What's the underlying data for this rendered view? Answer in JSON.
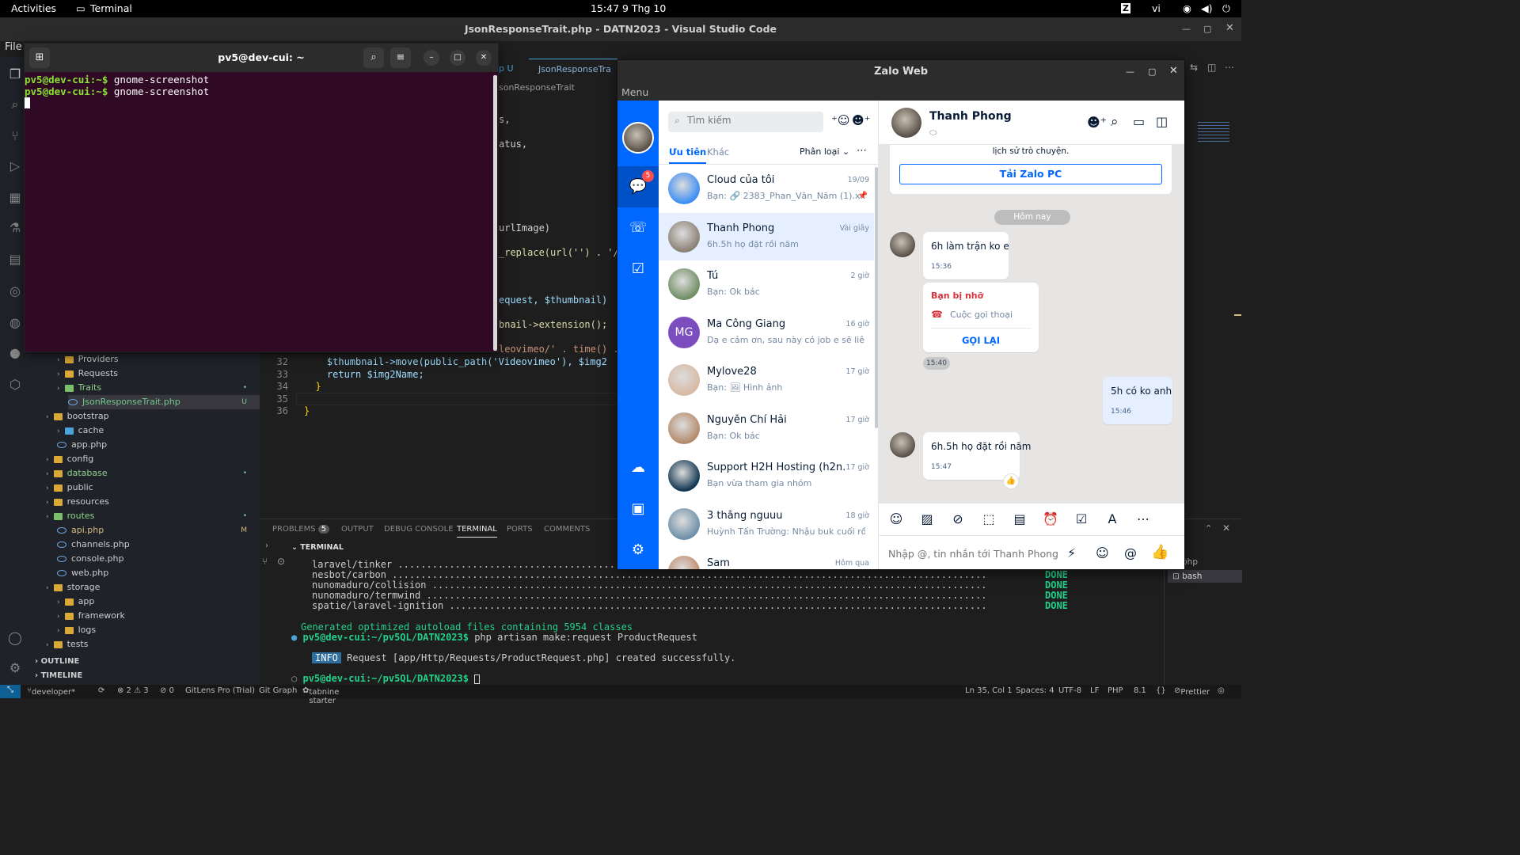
{
  "topbar": {
    "activities": "Activities",
    "app": "Terminal",
    "clock": "15:47  9 Thg 10",
    "lang": "vi"
  },
  "vscode": {
    "title": "JsonResponseTrait.php - DATN2023 - Visual Studio Code",
    "menu_file": "File",
    "tabs": [
      "p U",
      "JsonResponseTra"
    ],
    "breadcrumb": "sonResponseTrait",
    "code_right": [
      {
        "line": "",
        "text": "s,"
      },
      {
        "line": "",
        "text": "atus,"
      },
      {
        "line": "",
        "text": "urlImage)"
      },
      {
        "line": "",
        "text": "_replace(url('') . '/"
      },
      {
        "line": "",
        "text": "equest, $thumbnail)"
      },
      {
        "line": "",
        "text": "bnail->extension();"
      },
      {
        "line": "",
        "text": "leovimeo/' . time() ."
      }
    ],
    "code_lines": [
      {
        "n": "32",
        "text": "    $thumbnail->move(public_path('Videovimeo'), $img2"
      },
      {
        "n": "33",
        "text": "    return $img2Name;"
      },
      {
        "n": "34",
        "text": "  }"
      },
      {
        "n": "35",
        "text": ""
      },
      {
        "n": "36",
        "text": "}"
      }
    ],
    "explorer": [
      {
        "label": "Providers",
        "indent": 1,
        "kind": "folder"
      },
      {
        "label": "Requests",
        "indent": 1,
        "kind": "folder"
      },
      {
        "label": "Traits",
        "indent": 1,
        "kind": "folder-g",
        "badge": "•"
      },
      {
        "label": "JsonResponseTrait.php",
        "indent": 2,
        "kind": "php",
        "badge": "U"
      },
      {
        "label": "bootstrap",
        "indent": 0,
        "kind": "folder"
      },
      {
        "label": "cache",
        "indent": 1,
        "kind": "folder-b"
      },
      {
        "label": "app.php",
        "indent": 1,
        "kind": "php"
      },
      {
        "label": "config",
        "indent": 0,
        "kind": "folder"
      },
      {
        "label": "database",
        "indent": 0,
        "kind": "folder",
        "badge": "•"
      },
      {
        "label": "public",
        "indent": 0,
        "kind": "folder"
      },
      {
        "label": "resources",
        "indent": 0,
        "kind": "folder"
      },
      {
        "label": "routes",
        "indent": 0,
        "kind": "folder-g",
        "badge": "•"
      },
      {
        "label": "api.php",
        "indent": 1,
        "kind": "php",
        "badge": "M"
      },
      {
        "label": "channels.php",
        "indent": 1,
        "kind": "php"
      },
      {
        "label": "console.php",
        "indent": 1,
        "kind": "php"
      },
      {
        "label": "web.php",
        "indent": 1,
        "kind": "php"
      },
      {
        "label": "storage",
        "indent": 0,
        "kind": "folder"
      },
      {
        "label": "app",
        "indent": 1,
        "kind": "folder"
      },
      {
        "label": "framework",
        "indent": 1,
        "kind": "folder"
      },
      {
        "label": "logs",
        "indent": 1,
        "kind": "folder"
      },
      {
        "label": "tests",
        "indent": 0,
        "kind": "folder"
      }
    ],
    "outline": "OUTLINE",
    "timeline": "TIMELINE",
    "panel_tabs": {
      "problems": "PROBLEMS",
      "problems_count": "5",
      "output": "OUTPUT",
      "debug": "DEBUG CONSOLE",
      "terminal": "TERMINAL",
      "ports": "PORTS",
      "comments": "COMMENTS"
    },
    "terminal_header": "TERMINAL",
    "terminal_lines": [
      {
        "text": "laravel/tinker .......................................................................................................",
        "done": ""
      },
      {
        "text": "nesbot/carbon ........................................................................................................",
        "done": "DONE"
      },
      {
        "text": "nunomaduro/collision .................................................................................................",
        "done": "DONE"
      },
      {
        "text": "nunomaduro/termwind ..................................................................................................",
        "done": "DONE"
      },
      {
        "text": "spatie/laravel-ignition ..............................................................................................",
        "done": "DONE"
      }
    ],
    "generated": "Generated optimized autoload files containing 5954 classes",
    "prompt1": "pv5@dev-cui:~/pv5QL/DATN2023$",
    "cmd1": " php artisan make:request ProductRequest",
    "info_badge": "INFO",
    "info_text": " Request [app/Http/Requests/ProductRequest.php] created successfully.",
    "prompt2": "pv5@dev-cui:~/pv5QL/DATN2023$",
    "side_terms": [
      "php",
      "bash"
    ],
    "status": {
      "branch": "developer*",
      "errors": "⊗ 2 ⚠ 3",
      "ports": "⊘ 0",
      "gitlens": "GitLens Pro (Trial)",
      "gitgraph": "Git Graph",
      "tabnine": "tabnine starter",
      "pos": "Ln 35, Col 1",
      "spaces": "Spaces: 4",
      "enc": "UTF-8",
      "eol": "LF",
      "lang": "PHP",
      "ver": "8.1",
      "prettier": "Prettier"
    }
  },
  "terminal": {
    "title": "pv5@dev-cui: ~",
    "lines": [
      {
        "prompt": "pv5@dev-cui:~$",
        "cmd": " gnome-screenshot"
      },
      {
        "prompt": "pv5@dev-cui:~$",
        "cmd": " gnome-screenshot"
      }
    ]
  },
  "zalo": {
    "title": "Zalo Web",
    "menu": "Menu",
    "badge": "5",
    "search_placeholder": "Tìm kiếm",
    "tab_priority": "Ưu tiên",
    "tab_other": "Khác",
    "filter": "Phân loại",
    "conversations": [
      {
        "name": "Cloud của tôi",
        "preview": "Bạn: 🔗 2383_Phan_Văn_Năm (1).x...",
        "time": "19/09",
        "color": "#3d8df5"
      },
      {
        "name": "Thanh Phong",
        "preview": "6h.5h họ đặt rồi năm",
        "time": "Vài giây",
        "color": "#8a7f74",
        "active": true
      },
      {
        "name": "Tú",
        "preview": "Bạn: Ok bác",
        "time": "2 giờ",
        "color": "#6f8d63"
      },
      {
        "name": "Ma Công Giang",
        "preview": "Dạ e cảm ơn, sau này có job e sẽ liên ...",
        "time": "16 giờ",
        "color": "#7c4dbf",
        "initials": "MG"
      },
      {
        "name": "Mylove28",
        "preview": "Bạn: 🖼 Hình ảnh",
        "time": "17 giờ",
        "color": "#d7b9a3"
      },
      {
        "name": "Nguyễn Chí Hải",
        "preview": "Bạn: Ok bác",
        "time": "17 giờ",
        "color": "#b38a6b"
      },
      {
        "name": "Support H2H Hosting (h2n....",
        "preview": "Bạn vừa tham gia nhóm",
        "time": "17 giờ",
        "color": "#0f3550"
      },
      {
        "name": "3 thằng nguuu",
        "preview": "Huỳnh Tấn Trường: Nhậu buk cuối rồ...",
        "time": "18 giờ",
        "color": "#6d8fa8"
      },
      {
        "name": "Sam",
        "preview": "",
        "time": "Hôm qua",
        "color": "#c08a6a"
      }
    ],
    "chat": {
      "name": "Thanh Phong",
      "history_note": "lịch sử trò chuyện.",
      "download_btn": "Tải Zalo PC",
      "today": "Hôm nay",
      "msg1": "6h làm trận ko e",
      "msg1_time": "15:36",
      "missed_title": "Bạn bị nhỡ",
      "missed_call": "Cuộc gọi thoại",
      "call_back": "GỌI LẠI",
      "missed_time": "15:40",
      "msg2": "5h có ko anh",
      "msg2_time": "15:46",
      "msg3": "6h.5h họ đặt rồi năm",
      "msg3_time": "15:47",
      "input_placeholder": "Nhập @, tin nhắn tới Thanh Phong"
    }
  }
}
